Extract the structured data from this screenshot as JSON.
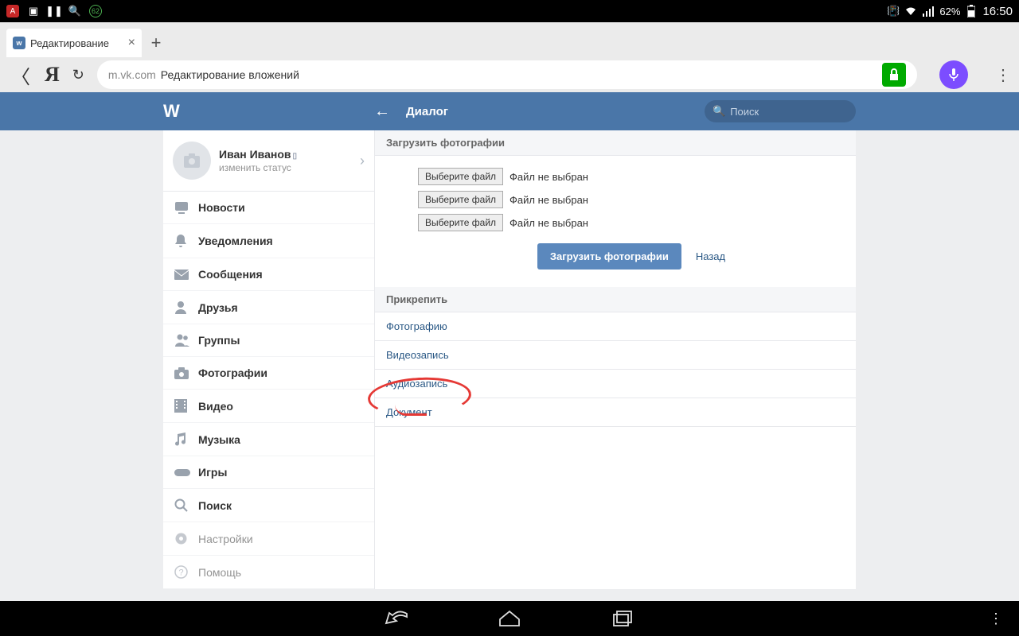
{
  "status_bar": {
    "battery_text": "62%",
    "clock": "16:50",
    "green_badge": "62"
  },
  "browser": {
    "tab_title": "Редактирование",
    "domain": "m.vk.com",
    "page_title": "Редактирование вложений"
  },
  "vk_header": {
    "title": "Диалог",
    "search_placeholder": "Поиск"
  },
  "profile": {
    "name": "Иван Иванов",
    "status": "изменить статус"
  },
  "sidebar": {
    "items": [
      {
        "label": "Новости"
      },
      {
        "label": "Уведомления"
      },
      {
        "label": "Сообщения"
      },
      {
        "label": "Друзья"
      },
      {
        "label": "Группы"
      },
      {
        "label": "Фотографии"
      },
      {
        "label": "Видео"
      },
      {
        "label": "Музыка"
      },
      {
        "label": "Игры"
      },
      {
        "label": "Поиск"
      },
      {
        "label": "Настройки"
      },
      {
        "label": "Помощь"
      }
    ]
  },
  "content": {
    "upload_heading": "Загрузить фотографии",
    "file_button": "Выберите файл",
    "file_status": "Файл не выбран",
    "submit": "Загрузить фотографии",
    "back": "Назад",
    "attach_heading": "Прикрепить",
    "attach_items": [
      "Фотографию",
      "Видеозапись",
      "Аудиозапись",
      "Документ"
    ]
  }
}
